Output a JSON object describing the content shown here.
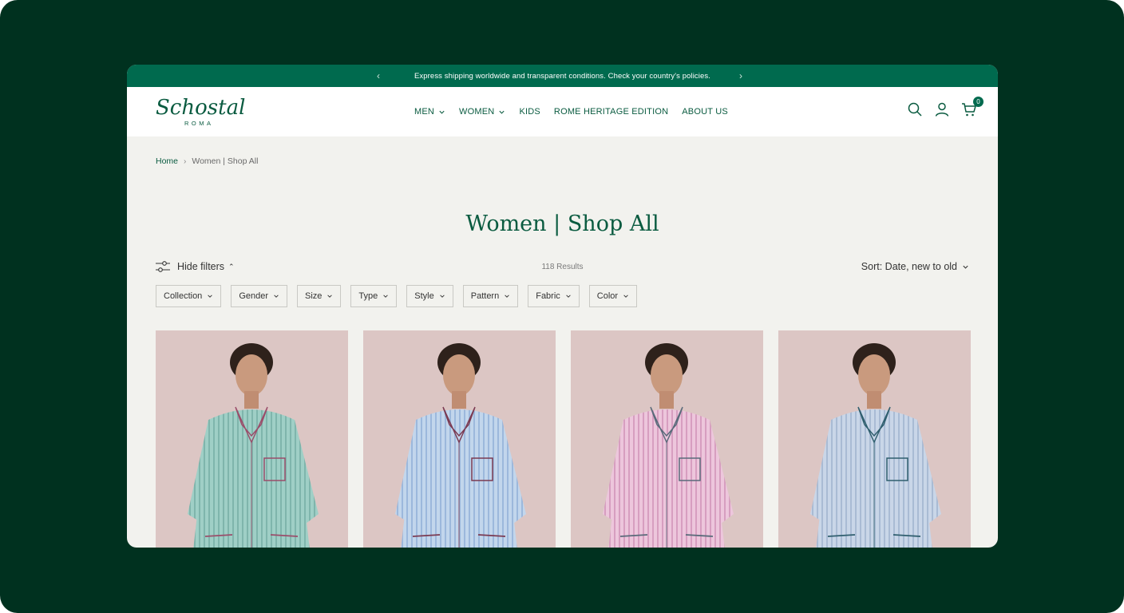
{
  "announcement": {
    "text": "Express shipping worldwide and transparent conditions. Check your country's policies.",
    "prev_icon": "chevron-left-icon",
    "next_icon": "chevron-right-icon"
  },
  "brand": {
    "script": "Schostal",
    "sub": "ROMA"
  },
  "nav": {
    "items": [
      {
        "label": "MEN",
        "dropdown": true
      },
      {
        "label": "WOMEN",
        "dropdown": true
      },
      {
        "label": "KIDS",
        "dropdown": false
      },
      {
        "label": "ROME HERITAGE EDITION",
        "dropdown": false
      },
      {
        "label": "ABOUT US",
        "dropdown": false
      }
    ]
  },
  "header_icons": {
    "search": "search-icon",
    "account": "user-icon",
    "cart": "cart-icon",
    "cart_count": "0"
  },
  "breadcrumb": {
    "home": "Home",
    "current": "Women | Shop All"
  },
  "page": {
    "title": "Women | Shop All"
  },
  "toolbar": {
    "hide_filters": "Hide filters",
    "results": "118 Results",
    "sort": "Sort: Date, new to old"
  },
  "filters": [
    "Collection",
    "Gender",
    "Size",
    "Type",
    "Style",
    "Pattern",
    "Fabric",
    "Color"
  ],
  "products": [
    {
      "color": "#9fcfc6",
      "stripe": "#7fb5ac",
      "piping": "#9a4d6a"
    },
    {
      "color": "#c2d6ec",
      "stripe": "#9cb8dc",
      "piping": "#7a3a52"
    },
    {
      "color": "#edc6dc",
      "stripe": "#d79ec0",
      "piping": "#5a6a7a"
    },
    {
      "color": "#c9d6e8",
      "stripe": "#a9bbd4",
      "piping": "#2f5e6e"
    }
  ],
  "colors": {
    "accent": "#006a4e",
    "dark_bg": "#00311f",
    "text_green": "#0a5b40",
    "page_bg": "#f2f2ee"
  }
}
